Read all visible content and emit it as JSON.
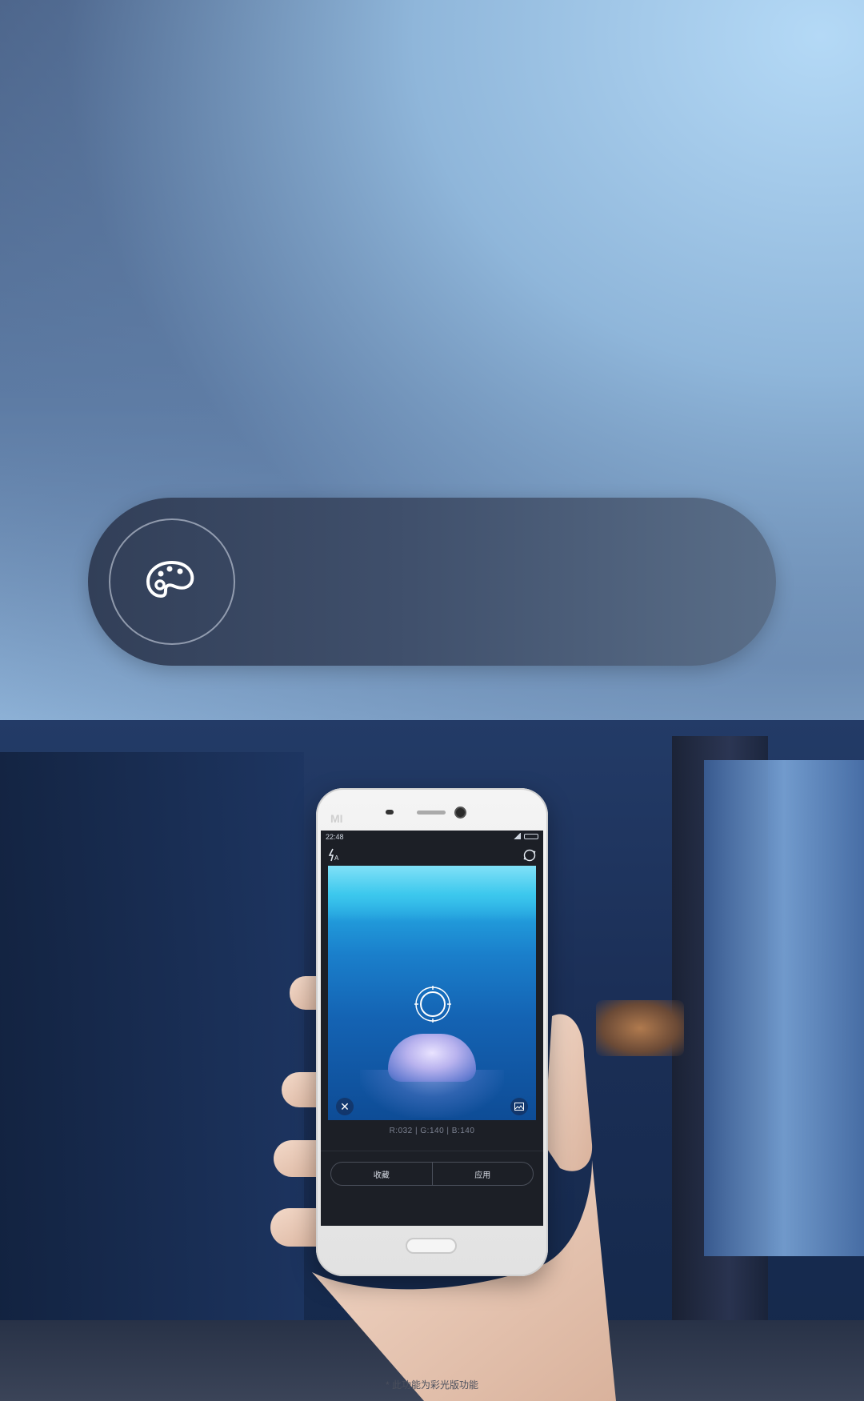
{
  "phone": {
    "brand_mark": "MI",
    "status_bar": {
      "time": "22:48"
    },
    "camera_screen": {
      "rgb_readout": "R:032 | G:140 | B:140",
      "buttons": {
        "collect": "收藏",
        "apply": "应用"
      }
    }
  },
  "pill": {
    "icon": "palette-icon"
  },
  "footnote": "* 此功能为彩光版功能",
  "colors": {
    "pill_start": "#323f58",
    "pill_end": "#5a6e88",
    "viewfinder_blue": "#1a7fcb"
  }
}
